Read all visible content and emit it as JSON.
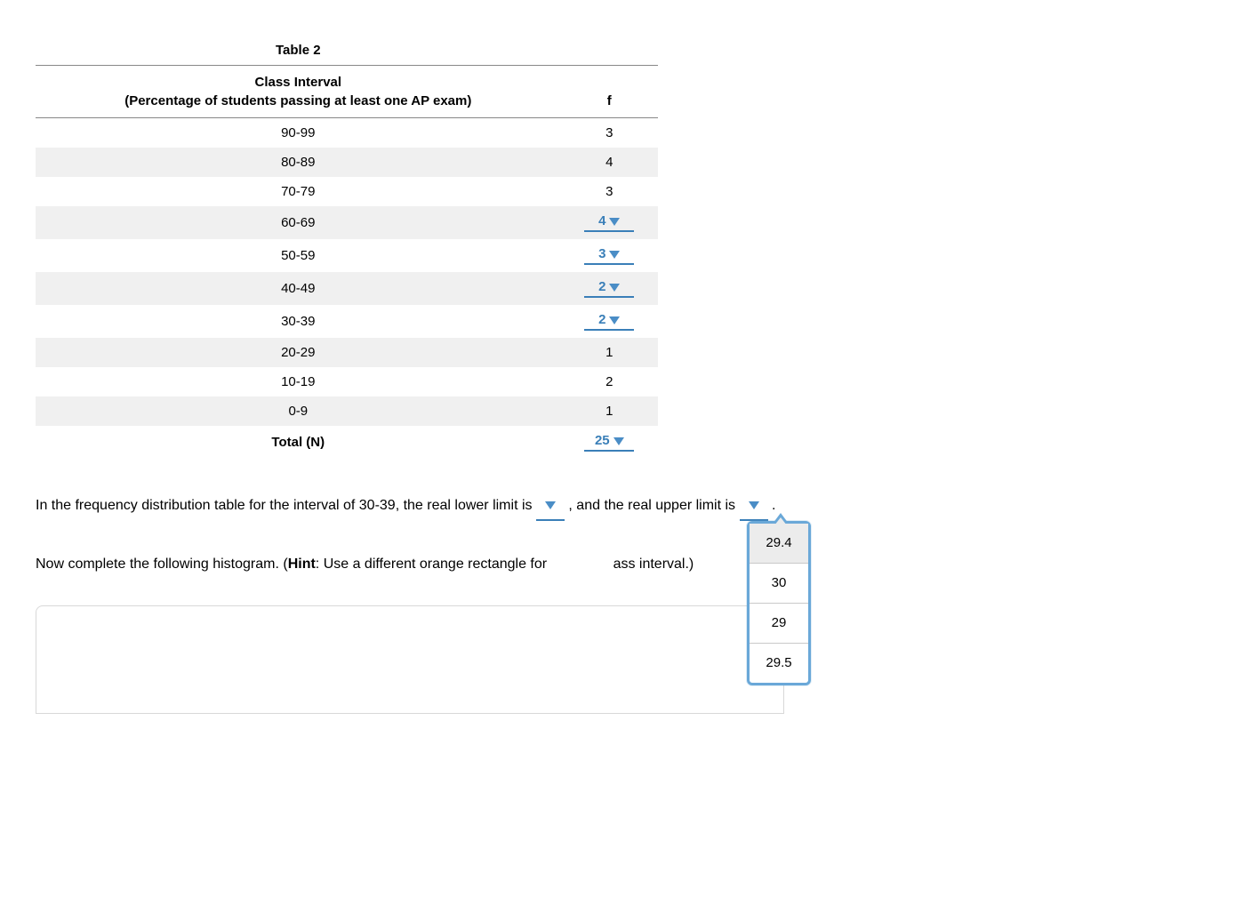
{
  "table": {
    "title": "Table 2",
    "header": {
      "col1_line1": "Class Interval",
      "col1_line2": "(Percentage of students passing at least one AP exam)",
      "col2": "f"
    },
    "rows": [
      {
        "interval": "90-99",
        "f": "3",
        "editable": false
      },
      {
        "interval": "80-89",
        "f": "4",
        "editable": false
      },
      {
        "interval": "70-79",
        "f": "3",
        "editable": false
      },
      {
        "interval": "60-69",
        "f": "4",
        "editable": true
      },
      {
        "interval": "50-59",
        "f": "3",
        "editable": true
      },
      {
        "interval": "40-49",
        "f": "2",
        "editable": true
      },
      {
        "interval": "30-39",
        "f": "2",
        "editable": true
      },
      {
        "interval": "20-29",
        "f": "1",
        "editable": false
      },
      {
        "interval": "10-19",
        "f": "2",
        "editable": false
      },
      {
        "interval": "0-9",
        "f": "1",
        "editable": false
      }
    ],
    "total": {
      "label": "Total (N)",
      "value": "25",
      "editable": true
    }
  },
  "sentence1": {
    "prefix": "In the frequency distribution table for the interval of 30-39, the real lower limit is ",
    "mid": " , and the real upper limit is ",
    "suffix": " ."
  },
  "sentence2": {
    "prefix": "Now complete the following histogram. (",
    "hint_label": "Hint",
    "hint_text": ": Use a different orange rectangle for",
    "obscured_tail": "ass interval.)"
  },
  "dropdown": {
    "options": [
      "29.4",
      "30",
      "29",
      "29.5"
    ],
    "selected_index": 0
  }
}
